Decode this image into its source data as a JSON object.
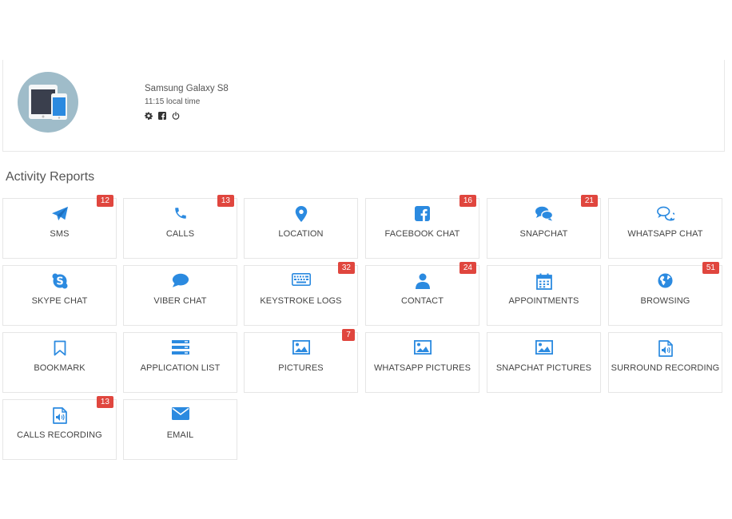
{
  "device": {
    "name": "Samsung Galaxy S8",
    "time": "11:15 local time",
    "avatar_icon": "devices-icon",
    "actions": [
      "gear-icon",
      "facebook-icon",
      "power-icon"
    ]
  },
  "section_title": "Activity Reports",
  "colors": {
    "accent": "#2b8ae0",
    "badge": "#e0463e",
    "avatar_bg": "#9fbcc9"
  },
  "tiles": [
    {
      "label": "SMS",
      "badge": "12",
      "icon": "send-icon"
    },
    {
      "label": "CALLS",
      "badge": "13",
      "icon": "phone-icon"
    },
    {
      "label": "LOCATION",
      "badge": null,
      "icon": "map-pin-icon"
    },
    {
      "label": "FACEBOOK CHAT",
      "badge": "16",
      "icon": "facebook-icon"
    },
    {
      "label": "SNAPCHAT",
      "badge": "21",
      "icon": "comments-icon"
    },
    {
      "label": "WHATSAPP CHAT",
      "badge": null,
      "icon": "comments-outline-icon"
    },
    {
      "label": "SKYPE CHAT",
      "badge": null,
      "icon": "skype-icon"
    },
    {
      "label": "VIBER CHAT",
      "badge": null,
      "icon": "chat-bubble-icon"
    },
    {
      "label": "KEYSTROKE LOGS",
      "badge": "32",
      "icon": "keyboard-icon"
    },
    {
      "label": "CONTACT",
      "badge": "24",
      "icon": "user-icon"
    },
    {
      "label": "APPOINTMENTS",
      "badge": null,
      "icon": "calendar-icon"
    },
    {
      "label": "BROWSING",
      "badge": "51",
      "icon": "globe-icon"
    },
    {
      "label": "BOOKMARK",
      "badge": null,
      "icon": "bookmark-icon"
    },
    {
      "label": "APPLICATION LIST",
      "badge": null,
      "icon": "list-icon"
    },
    {
      "label": "PICTURES",
      "badge": "7",
      "icon": "image-icon"
    },
    {
      "label": "WHATSAPP PICTURES",
      "badge": null,
      "icon": "image-icon"
    },
    {
      "label": "SNAPCHAT PICTURES",
      "badge": null,
      "icon": "image-icon"
    },
    {
      "label": "SURROUND RECORDING",
      "badge": null,
      "icon": "audio-file-icon"
    },
    {
      "label": "CALLS RECORDING",
      "badge": "13",
      "icon": "audio-file-icon"
    },
    {
      "label": "EMAIL",
      "badge": null,
      "icon": "envelope-icon"
    }
  ]
}
